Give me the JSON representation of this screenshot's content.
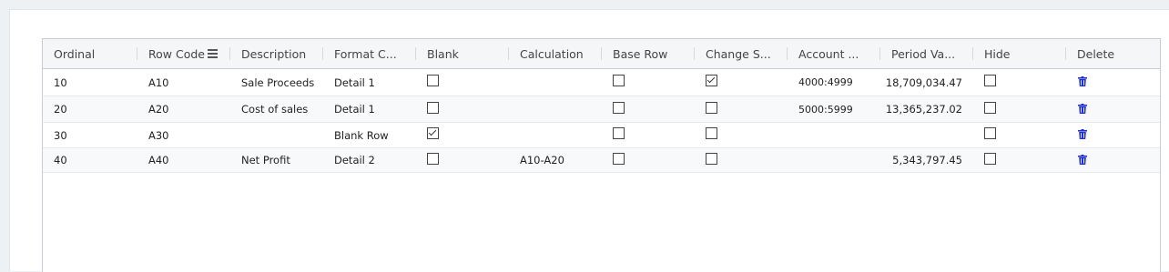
{
  "columns": [
    {
      "key": "ordinal",
      "label": "Ordinal"
    },
    {
      "key": "row_code",
      "label": "Row Code"
    },
    {
      "key": "description",
      "label": "Description"
    },
    {
      "key": "format",
      "label": "Format C..."
    },
    {
      "key": "blank",
      "label": "Blank"
    },
    {
      "key": "calculation",
      "label": "Calculation"
    },
    {
      "key": "base_row",
      "label": "Base Row"
    },
    {
      "key": "change_sign",
      "label": "Change S..."
    },
    {
      "key": "account",
      "label": "Account ..."
    },
    {
      "key": "period_value",
      "label": "Period Va..."
    },
    {
      "key": "hide",
      "label": "Hide"
    },
    {
      "key": "delete",
      "label": "Delete"
    }
  ],
  "rows": [
    {
      "ordinal": "10",
      "row_code": "A10",
      "description": "Sale Proceeds",
      "format": "Detail 1",
      "blank": false,
      "calculation": "",
      "base_row": false,
      "change_sign": true,
      "account": "4000:4999",
      "period_value": "18,709,034.47",
      "hide": false
    },
    {
      "ordinal": "20",
      "row_code": "A20",
      "description": "Cost of sales",
      "format": "Detail 1",
      "blank": false,
      "calculation": "",
      "base_row": false,
      "change_sign": false,
      "account": "5000:5999",
      "period_value": "13,365,237.02",
      "hide": false
    },
    {
      "ordinal": "30",
      "row_code": "A30",
      "description": "",
      "format": "Blank Row",
      "blank": true,
      "calculation": "",
      "base_row": false,
      "change_sign": false,
      "account": "",
      "period_value": "",
      "hide": false
    },
    {
      "ordinal": "40",
      "row_code": "A40",
      "description": "Net Profit",
      "format": "Detail 2",
      "blank": false,
      "calculation": "A10-A20",
      "base_row": false,
      "change_sign": false,
      "account": "",
      "period_value": "5,343,797.45",
      "hide": false
    }
  ],
  "icons": {
    "column_menu": "menu-lines-icon",
    "delete": "trash-icon"
  },
  "colors": {
    "delete_icon": "#1f2fd6",
    "header_bg": "#f5f6f7",
    "alt_row_bg": "#f7f9fb"
  }
}
